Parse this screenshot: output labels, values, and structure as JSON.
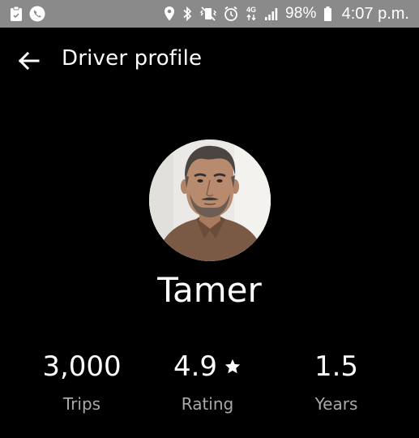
{
  "status_bar": {
    "battery_percent": "98%",
    "time": "4:07 p.m.",
    "network_type": "4G",
    "icons": [
      "clipboard-icon",
      "phone-call-icon",
      "location-pin-icon",
      "bluetooth-icon",
      "vibrate-icon",
      "alarm-icon",
      "data-arrows-icon",
      "signal-icon",
      "battery-icon"
    ],
    "background_color": "#8a8a8a"
  },
  "header": {
    "title": "Driver profile",
    "back_icon": "arrow-left-icon"
  },
  "driver": {
    "name": "Tamer",
    "avatar": "driver-photo"
  },
  "stats": [
    {
      "value": "3,000",
      "label": "Trips"
    },
    {
      "value": "4.9",
      "label": "Rating",
      "icon": "star-icon"
    },
    {
      "value": "1.5",
      "label": "Years"
    }
  ],
  "colors": {
    "background": "#000000",
    "primary_text": "#ffffff",
    "secondary_text": "#a9a9a9"
  }
}
